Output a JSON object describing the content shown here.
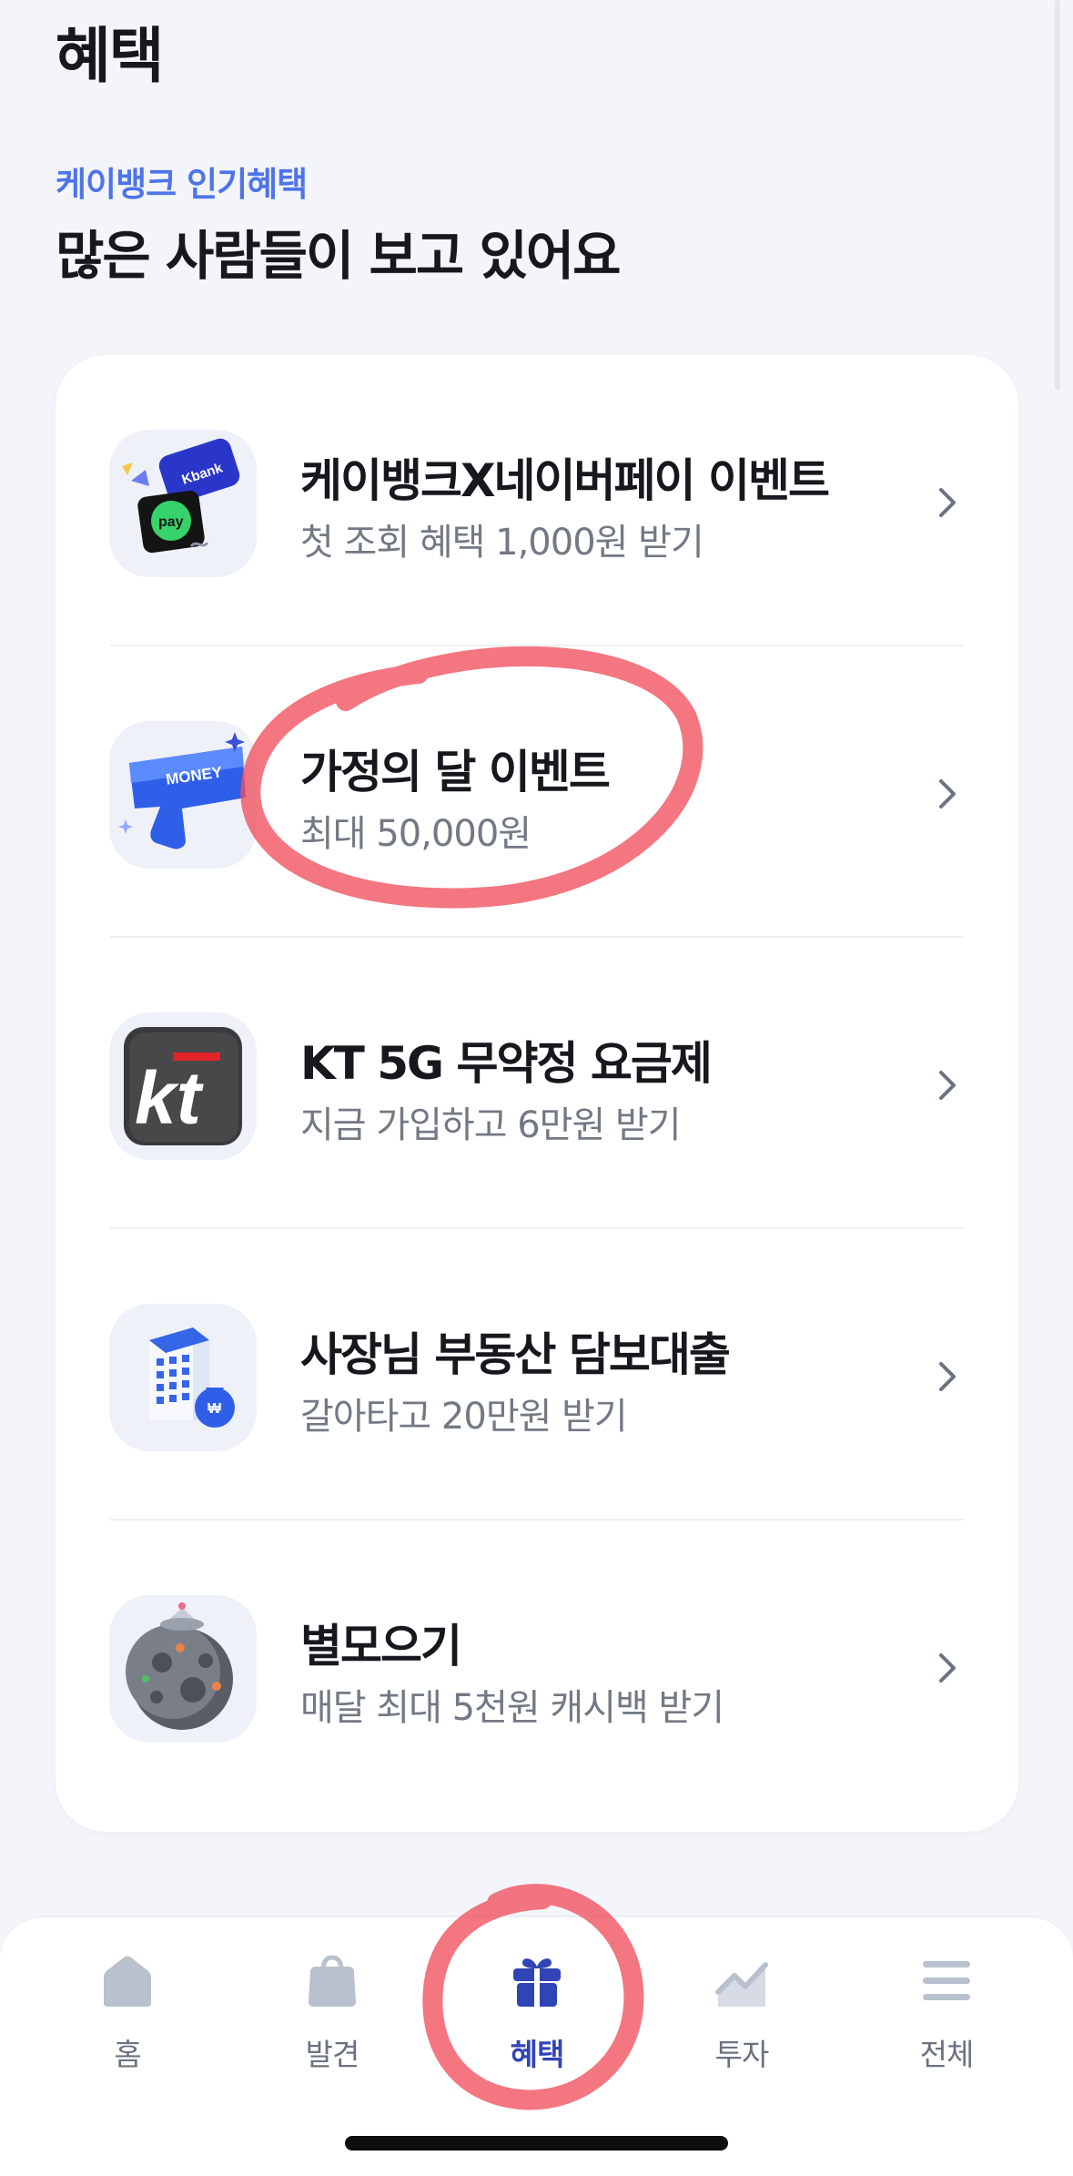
{
  "header": {
    "title": "혜택"
  },
  "section": {
    "eyebrow": "케이뱅크 인기혜택",
    "title": "많은 사람들이 보고 있어요"
  },
  "benefits": [
    {
      "title": "케이뱅크X네이버페이 이벤트",
      "subtitle": "첫 조회 혜택 1,000원 받기",
      "icon": "kbank-naverpay-icon"
    },
    {
      "title": "가정의 달 이벤트",
      "subtitle": "최대 50,000원",
      "icon": "money-gun-icon",
      "highlighted": true
    },
    {
      "title": "KT 5G 무약정 요금제",
      "subtitle": "지금 가입하고 6만원 받기",
      "icon": "kt-logo-icon"
    },
    {
      "title": "사장님 부동산 담보대출",
      "subtitle": "갈아타고 20만원 받기",
      "icon": "building-money-icon"
    },
    {
      "title": "별모으기",
      "subtitle": "매달 최대 5천원 캐시백 받기",
      "icon": "moon-planet-icon"
    }
  ],
  "tabbar": {
    "tabs": [
      {
        "label": "홈",
        "icon": "home-icon",
        "active": false
      },
      {
        "label": "발견",
        "icon": "shopping-bag-icon",
        "active": false
      },
      {
        "label": "혜택",
        "icon": "gift-icon",
        "active": true
      },
      {
        "label": "투자",
        "icon": "chart-icon",
        "active": false
      },
      {
        "label": "전체",
        "icon": "menu-icon",
        "active": false
      }
    ]
  },
  "colors": {
    "accent": "#4f74e8",
    "tab_active": "#3144b5",
    "tab_inactive": "#b9c1cf",
    "annotation": "#f0505e",
    "background": "#f3f5fa"
  }
}
